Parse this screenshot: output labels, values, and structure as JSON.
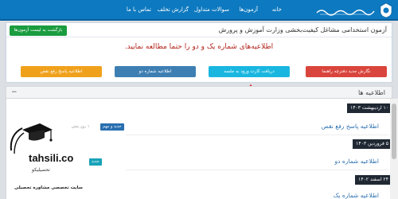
{
  "nav": {
    "items": [
      "خانه",
      "آزمون‌ها",
      "سوالات متداول",
      "گزارش تخلف",
      "تماس با ما"
    ]
  },
  "panel": {
    "title": "آزمون استخدامی مشاغل کیفیت‌بخشی وزارت آموزش و پرورش",
    "back_button": "بازگشت به لیست آزمون‌ها",
    "notice": "اطلاعیه‌های شماره یک و دو را حتما مطالعه نمایید.",
    "buttons": [
      "نگارش جدید دفترچه راهنما",
      "دریافت کارت ورود به جلسه",
      "اطلاعیه شماره دو",
      "اطلاعیه پاسخ رفع نقص"
    ]
  },
  "announcements": {
    "title": "اطلاعیه ها",
    "toggle": "−",
    "groups": [
      {
        "date": "۱۰ اردیبهشت ۱۴۰۳",
        "title": "اطلاعیه پاسخ رفع نقص",
        "badge_primary": "جدید و مهم",
        "badge_secondary": "",
        "ago": "۱ روز پیش"
      },
      {
        "date": "۵ فروردین ۱۴۰۳",
        "title": "اطلاعیه شماره دو",
        "badge_primary": "جدید",
        "badge_secondary": "",
        "ago": ""
      },
      {
        "date": "۲۴ اسفند ۱۴۰۲",
        "title": "اطلاعیه شماره یک",
        "badge_primary": "",
        "badge_secondary": "",
        "ago": ""
      }
    ]
  },
  "watermark": {
    "site": "tahsili.co",
    "brand_fa": "تحصیلیکو",
    "subtitle": "سایت تخصصی مشاوره تحصیلی"
  },
  "colors": {
    "topbar": "#0d79c0",
    "back_button": "#1a9c3f",
    "notice": "#b3261e",
    "btn_guide": "#d9453c",
    "btn_card": "#19b7e0",
    "btn_two": "#3e7fb3",
    "btn_fix": "#f0a11c",
    "badge_important": "#2a6fb0",
    "badge_new": "#17a2b8",
    "arrow": "#e3120b"
  }
}
